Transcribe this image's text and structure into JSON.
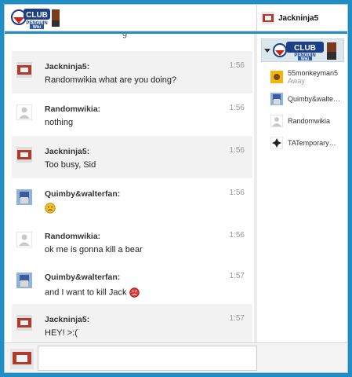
{
  "header": {
    "logo_text": "CLUB PENGUIN Wiki",
    "current_user": "Jackninja5"
  },
  "chat": {
    "partial_line": "g",
    "messages": [
      {
        "user": "Jackninja5:",
        "text": "Randomwikia what are you doing?",
        "time": "1:56",
        "avatar": "jackninja5-avatar",
        "shaded": true
      },
      {
        "user": "Randomwikia:",
        "text": "nothing",
        "time": "1:56",
        "avatar": "default-avatar",
        "shaded": false
      },
      {
        "user": "Jackninja5:",
        "text": "Too busy, Sid",
        "time": "1:56",
        "avatar": "jackninja5-avatar",
        "shaded": true
      },
      {
        "user": "Quimby&walterfan:",
        "text": "",
        "emote": "sad-face",
        "time": "1:56",
        "avatar": "quimby-avatar",
        "shaded": false
      },
      {
        "user": "Randomwikia:",
        "text": "ok me is gonna kill a bear",
        "time": "1:56",
        "avatar": "default-avatar",
        "shaded": false
      },
      {
        "user": "Quimby&walterfan:",
        "text": "and I want to kill Jack",
        "emote": "angry-face",
        "time": "1:57",
        "avatar": "quimby-avatar",
        "shaded": false
      },
      {
        "user": "Jackninja5:",
        "text": "HEY! >:(",
        "time": "1:57",
        "avatar": "jackninja5-avatar",
        "shaded": true
      }
    ]
  },
  "sidebar": {
    "users": [
      {
        "name": "55monkeyman5",
        "status": "Away",
        "avatar": "monkey-avatar"
      },
      {
        "name": "Quimby&walte…",
        "status": "",
        "avatar": "quimby-avatar"
      },
      {
        "name": "Randomwikia",
        "status": "",
        "avatar": "default-avatar"
      },
      {
        "name": "TATemporary…",
        "status": "",
        "avatar": "tatemp-avatar"
      }
    ]
  },
  "composer": {
    "value": "",
    "placeholder": ""
  },
  "colors": {
    "frame": "#1f8ec4",
    "shaded_row": "#f2f2f2",
    "time": "#999999"
  }
}
